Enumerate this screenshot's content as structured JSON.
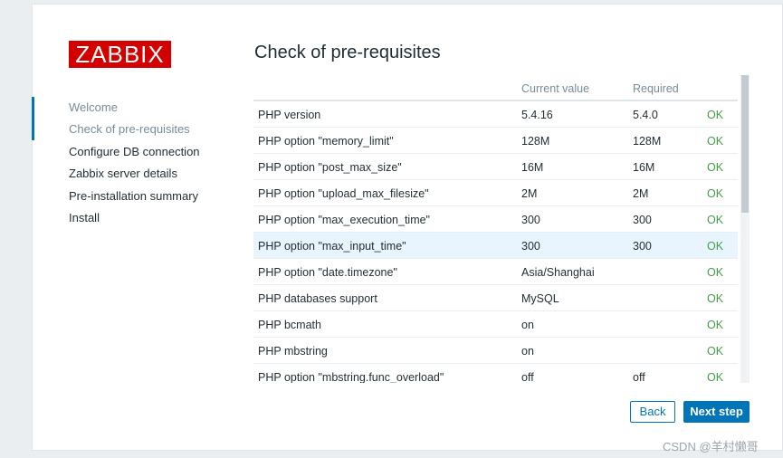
{
  "logo": {
    "text": "ZABBIX"
  },
  "steps": [
    {
      "label": "Welcome"
    },
    {
      "label": "Check of pre-requisites"
    },
    {
      "label": "Configure DB connection"
    },
    {
      "label": "Zabbix server details"
    },
    {
      "label": "Pre-installation summary"
    },
    {
      "label": "Install"
    }
  ],
  "page": {
    "title": "Check of pre-requisites"
  },
  "table": {
    "headers": {
      "current": "Current value",
      "required": "Required"
    },
    "rows": [
      {
        "name": "PHP version",
        "current": "5.4.16",
        "required": "5.4.0",
        "result": "OK"
      },
      {
        "name": "PHP option \"memory_limit\"",
        "current": "128M",
        "required": "128M",
        "result": "OK"
      },
      {
        "name": "PHP option \"post_max_size\"",
        "current": "16M",
        "required": "16M",
        "result": "OK"
      },
      {
        "name": "PHP option \"upload_max_filesize\"",
        "current": "2M",
        "required": "2M",
        "result": "OK"
      },
      {
        "name": "PHP option \"max_execution_time\"",
        "current": "300",
        "required": "300",
        "result": "OK"
      },
      {
        "name": "PHP option \"max_input_time\"",
        "current": "300",
        "required": "300",
        "result": "OK"
      },
      {
        "name": "PHP option \"date.timezone\"",
        "current": "Asia/Shanghai",
        "required": "",
        "result": "OK"
      },
      {
        "name": "PHP databases support",
        "current": "MySQL",
        "required": "",
        "result": "OK"
      },
      {
        "name": "PHP bcmath",
        "current": "on",
        "required": "",
        "result": "OK"
      },
      {
        "name": "PHP mbstring",
        "current": "on",
        "required": "",
        "result": "OK"
      },
      {
        "name": "PHP option \"mbstring.func_overload\"",
        "current": "off",
        "required": "off",
        "result": "OK"
      }
    ]
  },
  "buttons": {
    "back": "Back",
    "next": "Next step"
  },
  "watermark": "CSDN @羊村懒哥",
  "colors": {
    "brand": "#d40000",
    "accent": "#0275b8",
    "ok": "#429e47",
    "highlight": "#e8f5ff"
  }
}
